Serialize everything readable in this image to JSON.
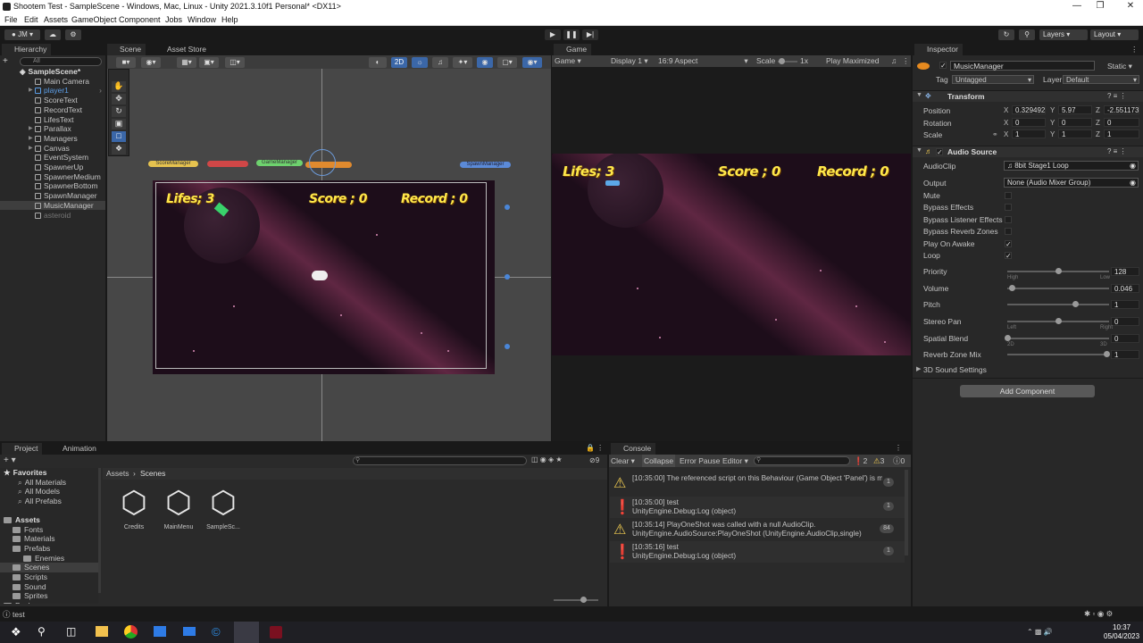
{
  "window": {
    "title": "Shootem Test - SampleScene - Windows, Mac, Linux - Unity 2021.3.10f1 Personal* <DX11>"
  },
  "menu": [
    "File",
    "Edit",
    "Assets",
    "GameObject",
    "Component",
    "Jobs",
    "Window",
    "Help"
  ],
  "toolbar": {
    "account": "JM",
    "layers": "Layers",
    "layout": "Layout"
  },
  "hierarchy": {
    "tab": "Hierarchy",
    "search_placeholder": "All",
    "scene": "SampleScene*",
    "items": [
      "Main Camera",
      "player1",
      "ScoreText",
      "RecordText",
      "LifesText",
      "Parallax",
      "Managers",
      "Canvas",
      "EventSystem",
      "SpawnerUp",
      "SpawnerMedium",
      "SpawnerBottom",
      "SpawnManager",
      "MusicManager",
      "asteroid"
    ]
  },
  "scene_view": {
    "tabs": [
      "Scene",
      "Asset Store"
    ],
    "mode_2d": "2D",
    "managers": [
      "ScoreManager",
      "GameManager",
      "SpawnManager"
    ],
    "hud": {
      "lifes": "Lifes; 3",
      "score": "Score ; 0",
      "record": "Record ; 0"
    }
  },
  "game_view": {
    "tab": "Game",
    "mode": "Game",
    "display": "Display 1",
    "aspect": "16:9 Aspect",
    "scale_label": "Scale",
    "scale_value": "1x",
    "play_mode": "Play Maximized",
    "hud": {
      "lifes": "Lifes; 3",
      "score": "Score ; 0",
      "record": "Record ; 0"
    }
  },
  "inspector": {
    "tab": "Inspector",
    "object_name": "MusicManager",
    "static_label": "Static",
    "tag_label": "Tag",
    "tag_value": "Untagged",
    "layer_label": "Layer",
    "layer_value": "Default",
    "transform": {
      "title": "Transform",
      "position_label": "Position",
      "position": [
        "0.329492",
        "5.97",
        "-2.551173"
      ],
      "rotation_label": "Rotation",
      "rotation": [
        "0",
        "0",
        "0"
      ],
      "scale_label": "Scale",
      "scale": [
        "1",
        "1",
        "1"
      ],
      "axis": [
        "X",
        "Y",
        "Z"
      ]
    },
    "audio_source": {
      "title": "Audio Source",
      "audioclip_label": "AudioClip",
      "audioclip": "8bit Stage1 Loop",
      "output_label": "Output",
      "output": "None (Audio Mixer Group)",
      "toggles": [
        {
          "label": "Mute",
          "checked": false
        },
        {
          "label": "Bypass Effects",
          "checked": false
        },
        {
          "label": "Bypass Listener Effects",
          "checked": false
        },
        {
          "label": "Bypass Reverb Zones",
          "checked": false
        },
        {
          "label": "Play On Awake",
          "checked": true
        },
        {
          "label": "Loop",
          "checked": true
        }
      ],
      "sliders": [
        {
          "label": "Priority",
          "value": "128",
          "min_label": "High",
          "max_label": "Low",
          "fraction": 0.5
        },
        {
          "label": "Volume",
          "value": "0.046",
          "fraction": 0.046
        },
        {
          "label": "Pitch",
          "value": "1",
          "fraction": 0.67
        },
        {
          "label": "Stereo Pan",
          "value": "0",
          "min_label": "Left",
          "max_label": "Right",
          "fraction": 0.5
        },
        {
          "label": "Spatial Blend",
          "value": "0",
          "min_label": "2D",
          "max_label": "3D",
          "fraction": 0.0
        },
        {
          "label": "Reverb Zone Mix",
          "value": "1",
          "fraction": 0.97
        }
      ],
      "sound_settings": "3D Sound Settings"
    },
    "add_component": "Add Component"
  },
  "project": {
    "tabs": [
      "Project",
      "Animation"
    ],
    "favorites_label": "Favorites",
    "favorites": [
      "All Materials",
      "All Models",
      "All Prefabs"
    ],
    "assets_label": "Assets",
    "assets_tree": [
      "Fonts",
      "Materials",
      "Prefabs",
      "Enemies",
      "Scenes",
      "Scripts",
      "Sound",
      "Sprites",
      "Packages"
    ],
    "breadcrumb": [
      "Assets",
      "Scenes"
    ],
    "files": [
      "Credits",
      "MainMenu",
      "SampleSc..."
    ],
    "hidden_count": "9"
  },
  "console": {
    "tab": "Console",
    "buttons": [
      "Clear",
      "Collapse",
      "Error Pause",
      "Editor"
    ],
    "counts": {
      "errors": "2",
      "warnings": "3",
      "logs": "0"
    },
    "messages": [
      {
        "type": "warning",
        "line1": "[10:35:00] The referenced script on this Behaviour (Game Object 'Panel') is missin",
        "line2": "",
        "count": "1"
      },
      {
        "type": "info",
        "line1": "[10:35:00] test",
        "line2": "UnityEngine.Debug:Log (object)",
        "count": "1"
      },
      {
        "type": "warning",
        "line1": "[10:35:14] PlayOneShot was called with a null AudioClip.",
        "line2": "UnityEngine.AudioSource:PlayOneShot (UnityEngine.AudioClip,single)",
        "count": "84"
      },
      {
        "type": "info",
        "line1": "[10:35:16] test",
        "line2": "UnityEngine.Debug:Log (object)",
        "count": "1"
      }
    ]
  },
  "statusbar": {
    "text": "test"
  },
  "taskbar": {
    "time": "10:37",
    "date": "05/04/2023"
  }
}
